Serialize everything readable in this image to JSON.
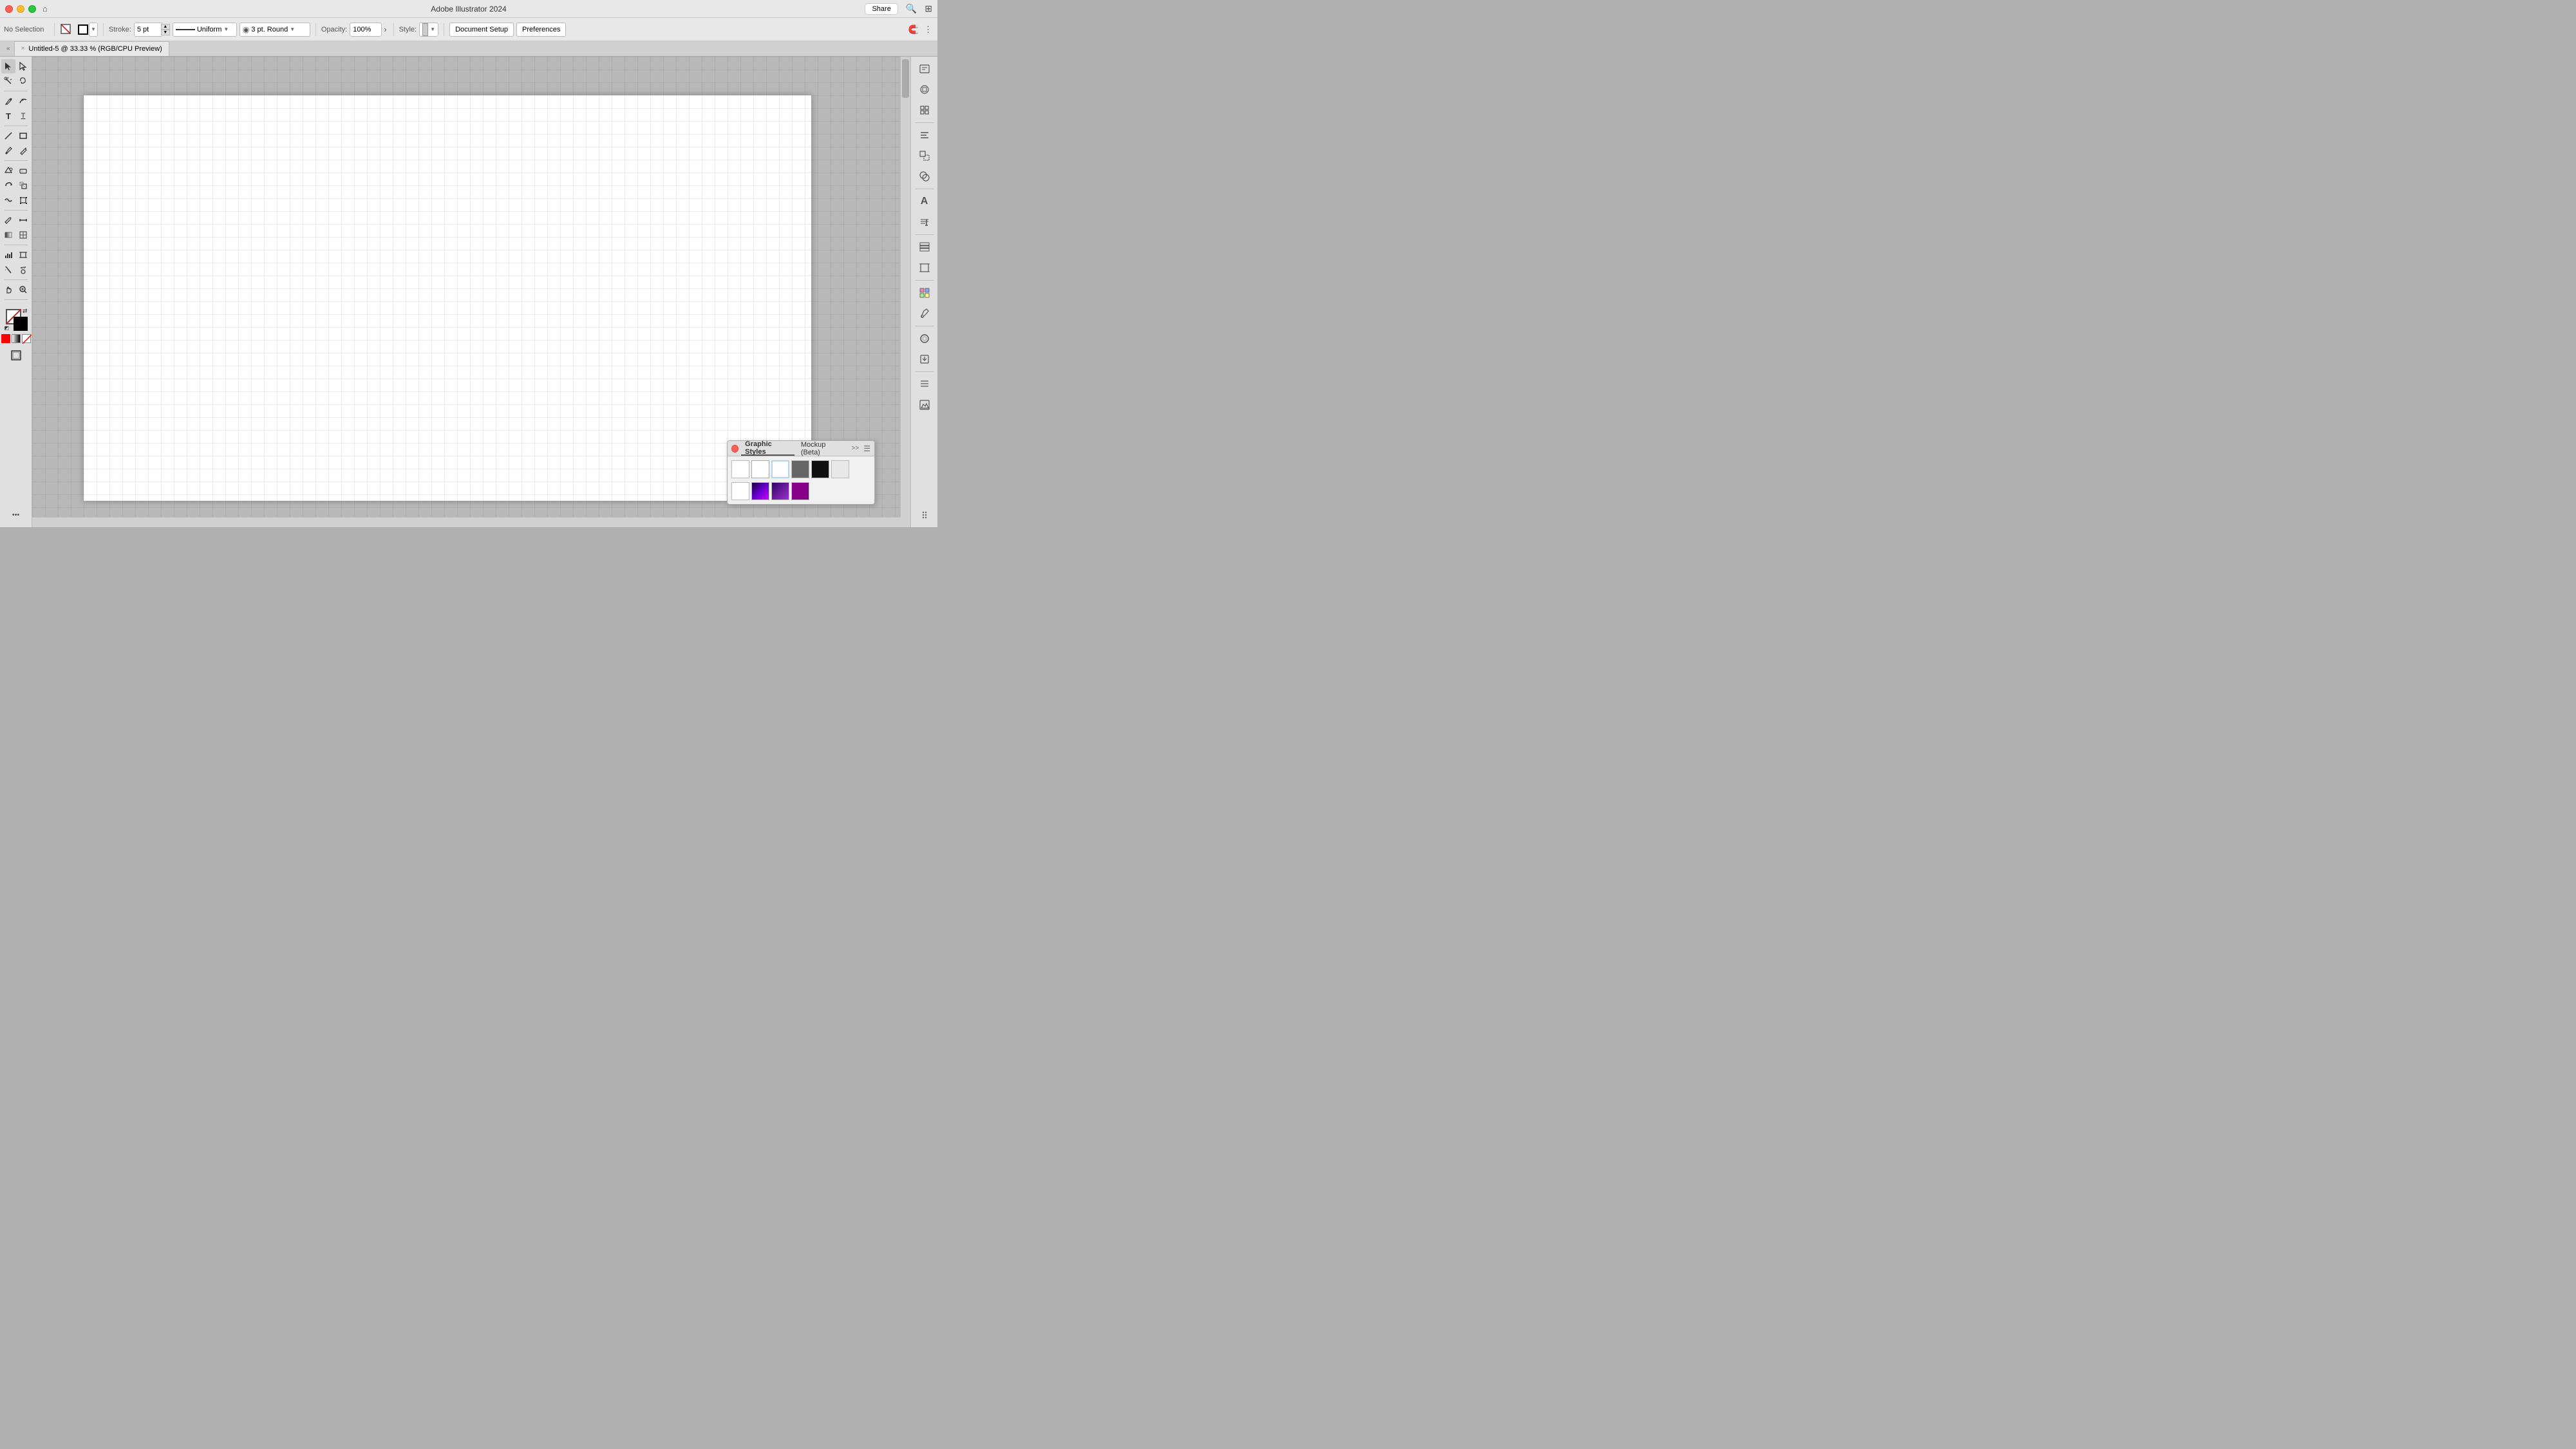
{
  "app": {
    "title": "Adobe Illustrator 2024"
  },
  "titlebar": {
    "share_label": "Share",
    "document_title": "Adobe Illustrator 2024"
  },
  "toolbar": {
    "no_selection_label": "No Selection",
    "stroke_label": "Stroke:",
    "stroke_weight": "5 pt",
    "stroke_type": "Uniform",
    "stroke_cap": "3 pt. Round",
    "opacity_label": "Opacity:",
    "opacity_value": "100%",
    "style_label": "Style:",
    "document_setup_label": "Document Setup",
    "preferences_label": "Preferences"
  },
  "tab": {
    "title": "Untitled-5 @ 33.33 % (RGB/CPU Preview)",
    "close_label": "×"
  },
  "tools": {
    "selection": "▶",
    "direct_selection": "↖",
    "magic_wand": "✦",
    "lasso": "⬭",
    "pen": "✒",
    "curvature": "〜",
    "type": "T",
    "touch_type": "T̲",
    "line": "/",
    "rectangle": "▭",
    "paint_brush": "🖌",
    "pencil": "✏",
    "shaper": "⬡",
    "eraser": "◫",
    "rotate": "↺",
    "scale": "⤢",
    "warp": "≋",
    "free_transform": "⊞",
    "eyedropper": "💧",
    "measure": "📏",
    "gradient": "▦",
    "mesh": "⊞",
    "shape_builder": "⊎",
    "live_paint": "🪣",
    "artboard": "⬜",
    "slice": "✂",
    "hand": "✋",
    "zoom": "🔍"
  },
  "colors": {
    "fill": "#ffffff",
    "stroke": "#000000",
    "accent_red": "#ff0000",
    "accent_blue": "#a0c8e8"
  },
  "rightpanel": {
    "icons": [
      "properties",
      "libraries",
      "transform",
      "align",
      "pathfinder",
      "glyphs",
      "paragraph",
      "character",
      "layers",
      "artboards",
      "swatches",
      "brushes"
    ]
  },
  "graphic_styles_panel": {
    "title": "Graphic Styles",
    "tab2": "Mockup (Beta)",
    "expand_icon": ">>",
    "styles": [
      {
        "id": 1,
        "type": "white"
      },
      {
        "id": 2,
        "type": "white2"
      },
      {
        "id": 3,
        "type": "outline-blue"
      },
      {
        "id": 4,
        "type": "dark"
      },
      {
        "id": 5,
        "type": "black"
      },
      {
        "id": 6,
        "type": "light-gray"
      },
      {
        "id": 7,
        "type": "white"
      },
      {
        "id": 8,
        "type": "purple-gradient"
      },
      {
        "id": 9,
        "type": "dark-purple"
      },
      {
        "id": 10,
        "type": "magenta"
      }
    ]
  }
}
